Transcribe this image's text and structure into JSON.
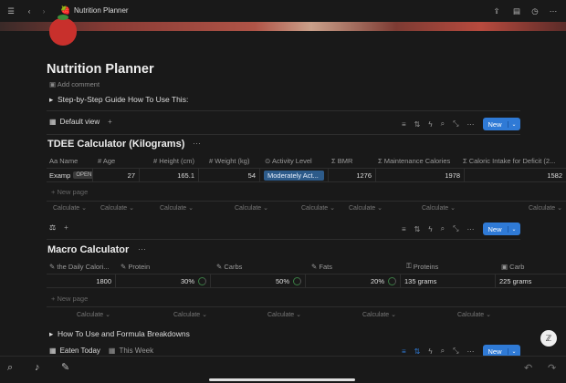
{
  "app": {
    "title": "Nutrition Planner",
    "page_icon": "🍓"
  },
  "page": {
    "title": "Nutrition Planner",
    "add_comment": "Add comment",
    "toggle_guide": "Step-by-Step Guide How To Use This:",
    "toggle_formula": "How To Use and Formula Breakdowns",
    "new_page": "+ New page"
  },
  "toolbar": {
    "default_view": "Default view",
    "new_label": "New",
    "eaten_today": "Eaten Today",
    "this_week": "This Week"
  },
  "tdee": {
    "title": "TDEE Calculator (Kilograms)",
    "columns": [
      "Aa Name",
      "# Age",
      "# Height (cm)",
      "# Weight (kg)",
      "⊙ Activity Level",
      "Σ BMR",
      "Σ Maintenance Calories",
      "Σ Caloric Intake for Deficit (2..."
    ],
    "row": {
      "name": "Examp",
      "open": "OPEN",
      "age": "27",
      "height": "165.1",
      "weight": "54",
      "activity": "Moderately Act...",
      "bmr": "1276",
      "maintenance": "1978",
      "deficit": "1582"
    },
    "calc_labels": [
      "Calculate ⌄",
      "Calculate ⌄",
      "Calculate ⌄",
      "Calculate ⌄",
      "Calculate ⌄",
      "Calculate ⌄",
      "Calculate ⌄",
      "Calculate ⌄"
    ]
  },
  "macro": {
    "title": "Macro Calculator",
    "columns": [
      "the Daily Calori...",
      "Protein",
      "Carbs",
      "Fats",
      "Proteins",
      "Carb"
    ],
    "row": {
      "daily": "1800",
      "protein": "30%",
      "carbs": "50%",
      "fats": "20%",
      "proteins_g": "135 grams",
      "carb_g": "225 grams"
    },
    "calc_labels": [
      "Calculate ⌄",
      "Calculate ⌄",
      "Calculate ⌄",
      "Calculate ⌄",
      "Calculate ⌄",
      "Calculate ⌄"
    ]
  },
  "colors": {
    "accent": "#2f7ad6",
    "select_bg": "#2d5b8a",
    "ring_green": "#3a7d44",
    "bg": "#191919"
  }
}
